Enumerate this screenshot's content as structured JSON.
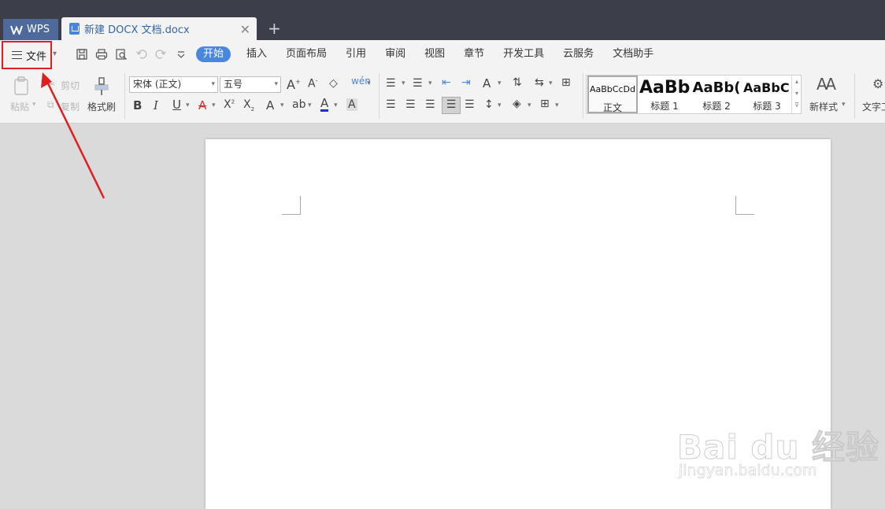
{
  "titlebar": {
    "app_tab": "WPS",
    "doc_tab": "新建 DOCX 文档.docx",
    "close_glyph": "✕",
    "new_tab_glyph": "+"
  },
  "menubar": {
    "file_label": "文件",
    "tabs": [
      "开始",
      "插入",
      "页面布局",
      "引用",
      "审阅",
      "视图",
      "章节",
      "开发工具",
      "云服务",
      "文档助手"
    ],
    "active_tab": "开始"
  },
  "ribbon": {
    "paste_label": "粘贴",
    "cut_label": "剪切",
    "copy_label": "复制",
    "format_painter_label": "格式刷",
    "font_name": "宋体 (正文)",
    "font_size": "五号",
    "styles": [
      {
        "preview": "AaBbCcDd",
        "label": "正文"
      },
      {
        "preview": "AaBb",
        "label": "标题 1"
      },
      {
        "preview": "AaBb(",
        "label": "标题 2"
      },
      {
        "preview": "AaBbC(",
        "label": "标题 3"
      }
    ],
    "new_style_label": "新样式",
    "text_tools_label": "文字工"
  },
  "watermark": {
    "brand": "Bai du 经验",
    "site": "jingyan.baidu.com"
  },
  "colors": {
    "titlebar": "#3c3f4a",
    "accent": "#4a86e0",
    "highlight_box": "#e02020"
  }
}
